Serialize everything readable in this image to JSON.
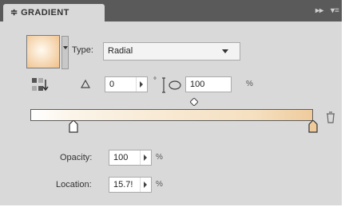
{
  "panel": {
    "title": "≑ GRADIENT",
    "collapse_label": "▸▸",
    "menu_label": "▾≡"
  },
  "type": {
    "label": "Type:",
    "value": "Radial"
  },
  "angle": {
    "value": "0",
    "unit": "°"
  },
  "aspect": {
    "value": "100",
    "unit": "%"
  },
  "opacity": {
    "label": "Opacity:",
    "value": "100",
    "unit": "%"
  },
  "location": {
    "label": "Location:",
    "value": "15.7!",
    "unit": "%"
  },
  "gradient": {
    "colors": [
      "#ffffff",
      "#f5dfbf",
      "#efcb9c"
    ],
    "midpoint_percent": 57,
    "selected_stop_percent": 15.7,
    "stops_percent": [
      15.7,
      100
    ]
  },
  "icons": {
    "swatch": "gradient-fill-swatch-icon",
    "reverse": "reverse-gradient-icon",
    "angle": "angle-icon",
    "aspect": "aspect-ratio-icon",
    "delete_stop": "delete-stop-icon"
  }
}
